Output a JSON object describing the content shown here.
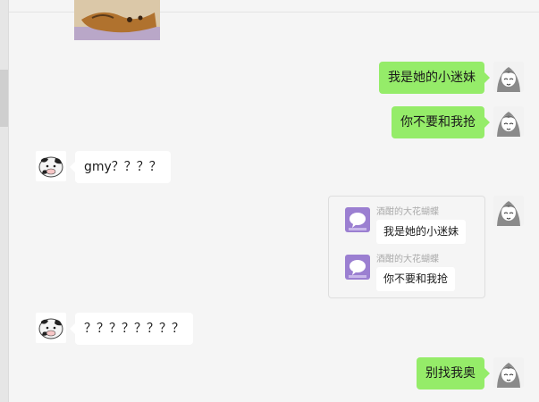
{
  "messages": [
    {
      "sender": "me",
      "text": "我是她的小迷妹"
    },
    {
      "sender": "me",
      "text": "你不要和我抢"
    },
    {
      "sender": "other",
      "text": "gmy？？？？"
    },
    {
      "sender": "other",
      "text": "？？？？？？？？"
    },
    {
      "sender": "me",
      "text": "别找我奥"
    }
  ],
  "chat_record": {
    "entries": [
      {
        "name": "酒酣的大花蝴蝶",
        "text": "我是她的小迷妹"
      },
      {
        "name": "酒酣的大花蝴蝶",
        "text": "你不要和我抢"
      }
    ]
  },
  "icons": {
    "my_avatar": "anime-girl-avatar-icon",
    "other_avatar": "cow-avatar-icon",
    "record_avatar": "purple-bubble-avatar-icon"
  },
  "colors": {
    "my_bubble": "#95ec69",
    "other_bubble": "#ffffff",
    "chat_background": "#f5f5f5"
  }
}
